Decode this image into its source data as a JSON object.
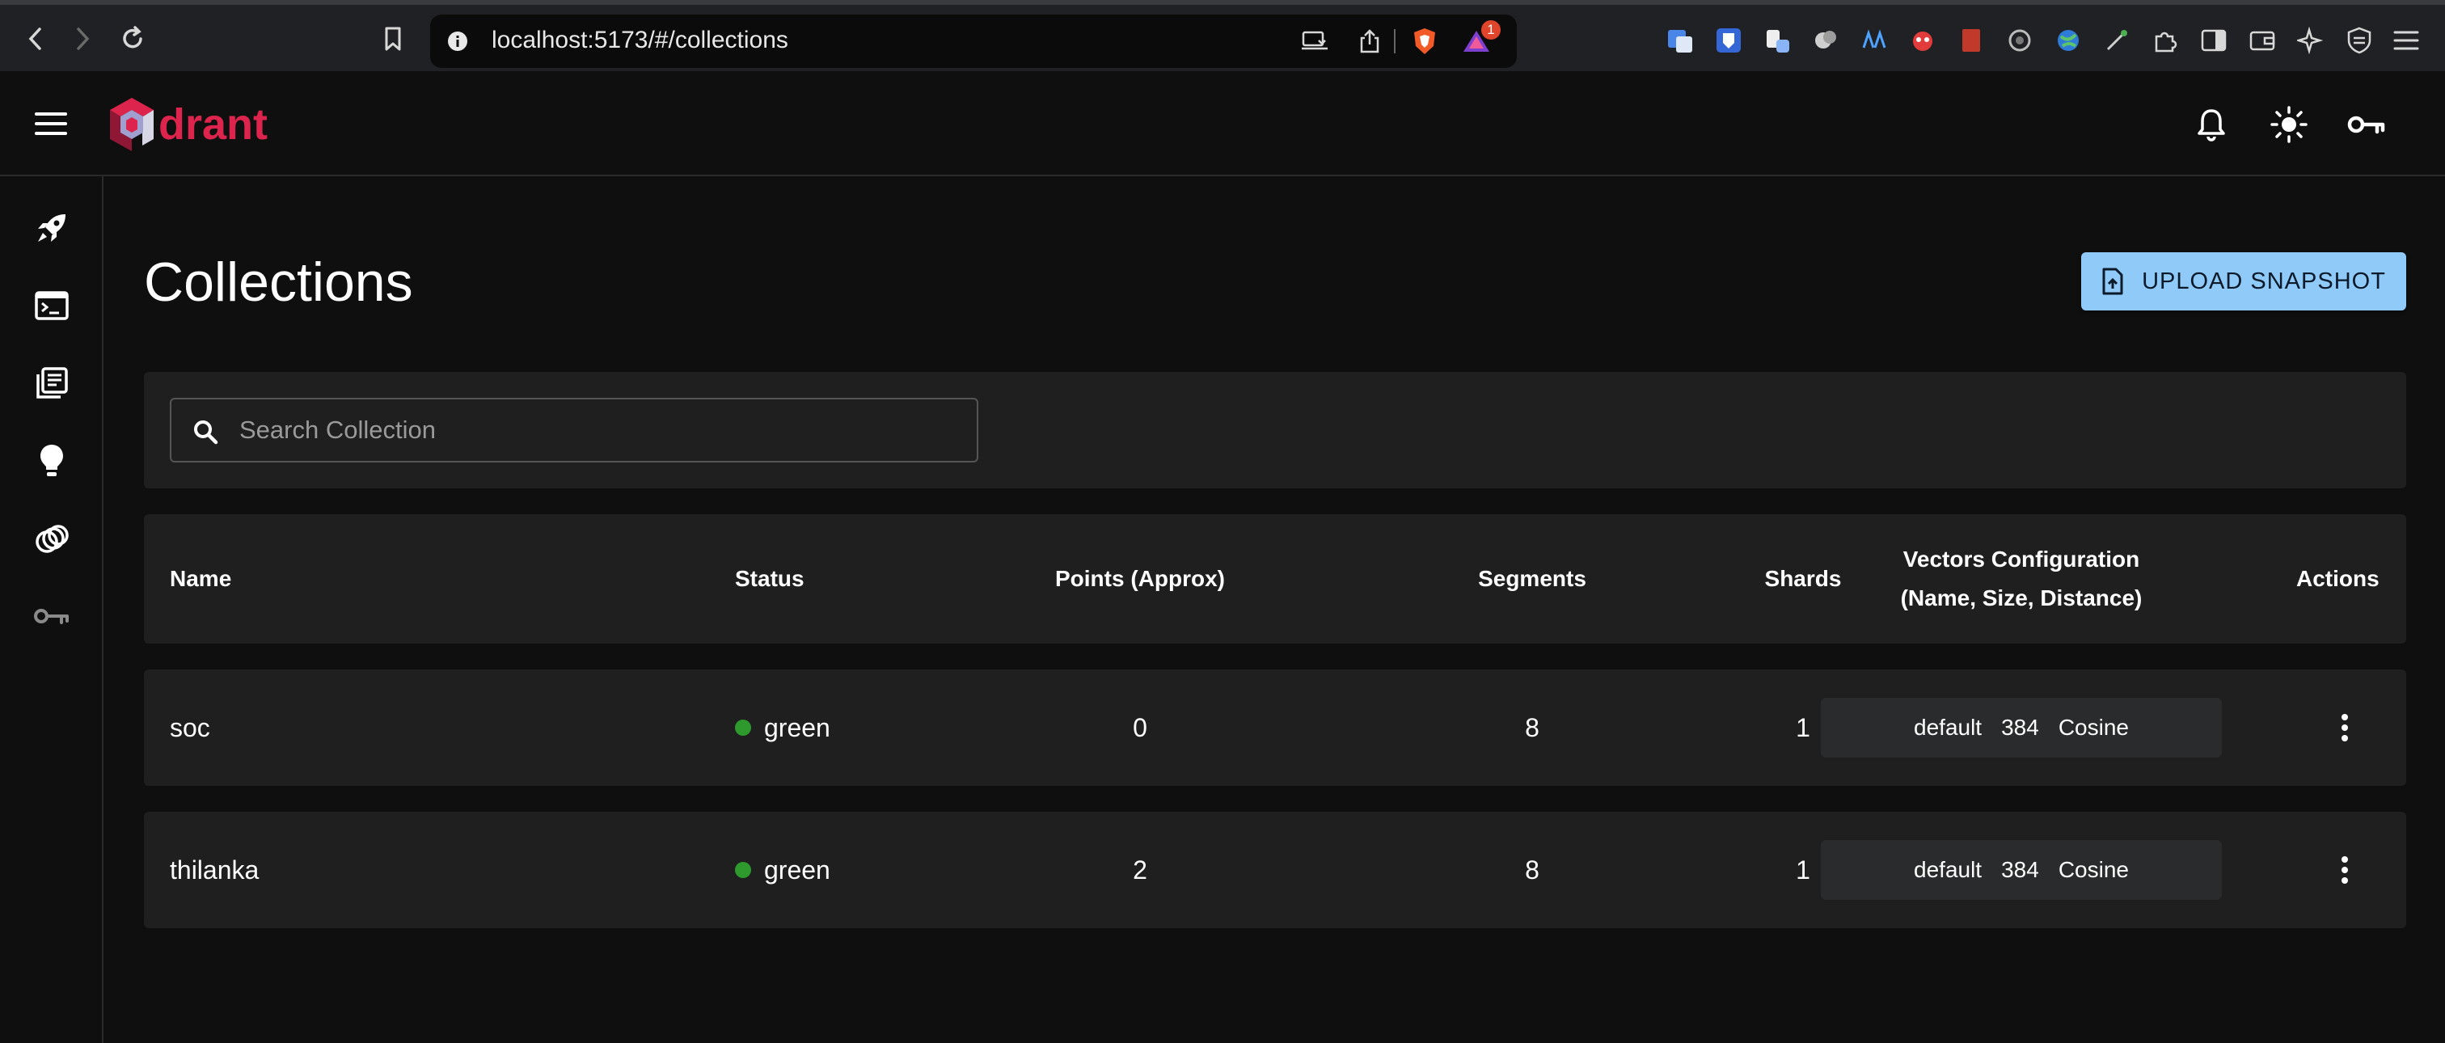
{
  "browser": {
    "url": "localhost:5173/#/collections",
    "notification_count": "1"
  },
  "header": {
    "logo_text": "drant",
    "brand_color": "#dc244c"
  },
  "sidebar": {
    "items": [
      {
        "icon": "rocket-icon"
      },
      {
        "icon": "console-icon"
      },
      {
        "icon": "collections-icon"
      },
      {
        "icon": "lightbulb-icon"
      },
      {
        "icon": "datasets-icon"
      },
      {
        "icon": "key-icon"
      }
    ]
  },
  "main": {
    "title": "Collections",
    "upload_label": "UPLOAD SNAPSHOT",
    "search_placeholder": "Search Collection"
  },
  "table": {
    "headers": {
      "name": "Name",
      "status": "Status",
      "points": "Points (Approx)",
      "segments": "Segments",
      "shards": "Shards",
      "vectors_line1": "Vectors Configuration",
      "vectors_line2": "(Name, Size, Distance)",
      "actions": "Actions"
    },
    "rows": [
      {
        "name": "soc",
        "status": "green",
        "points": "0",
        "segments": "8",
        "shards": "1",
        "vector_name": "default",
        "vector_size": "384",
        "vector_distance": "Cosine"
      },
      {
        "name": "thilanka",
        "status": "green",
        "points": "2",
        "segments": "8",
        "shards": "1",
        "vector_name": "default",
        "vector_size": "384",
        "vector_distance": "Cosine"
      }
    ],
    "status_color": "#2e9a2e"
  }
}
